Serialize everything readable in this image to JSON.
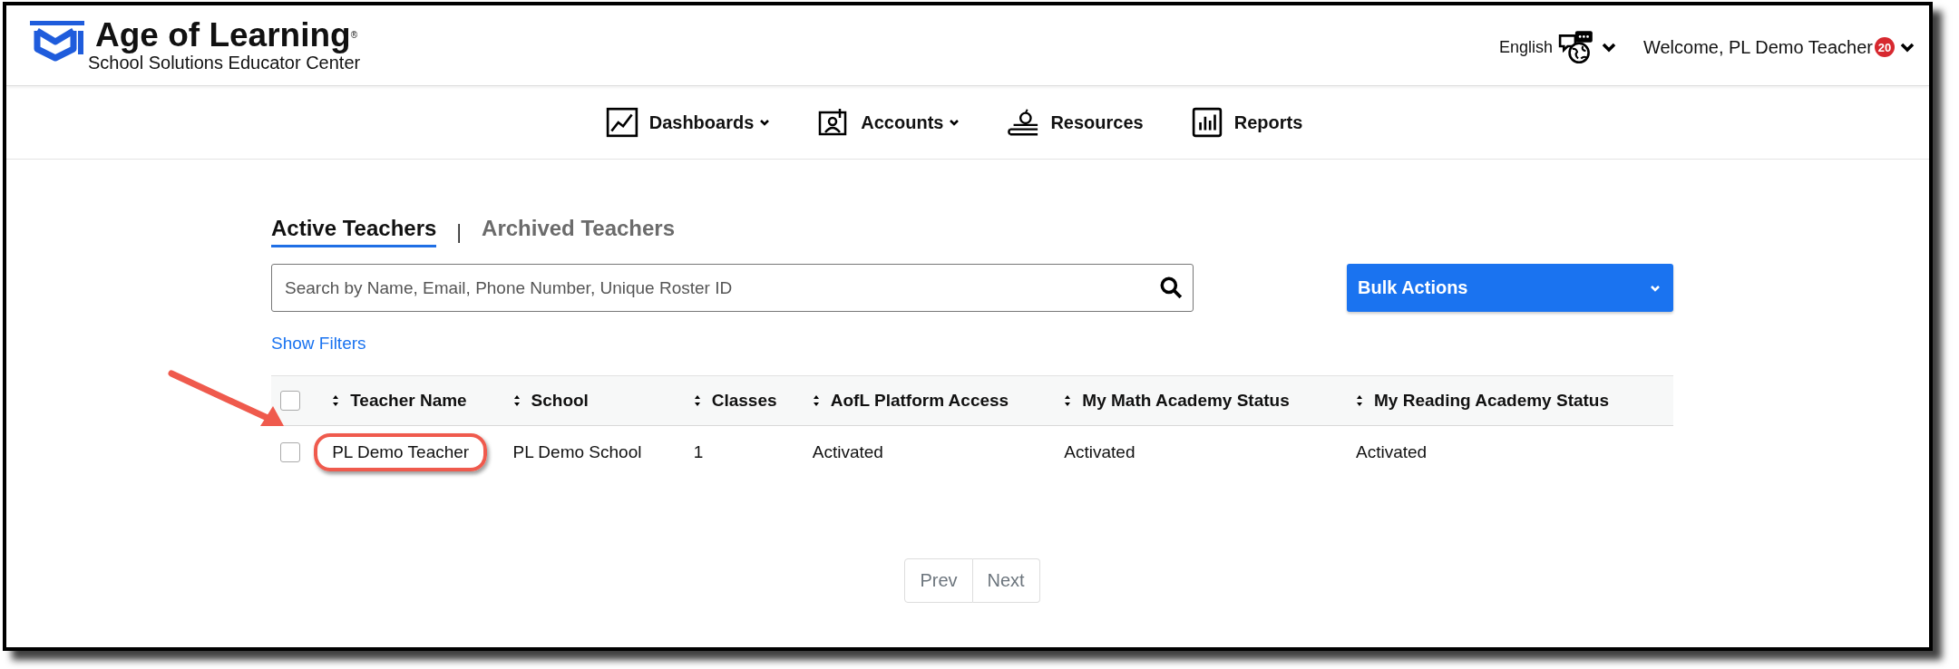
{
  "header": {
    "brand": "Age of Learning",
    "registered": "®",
    "subtitle": "School Solutions Educator Center",
    "language": "English",
    "welcome": "Welcome, PL Demo Teacher",
    "notification_count": "20"
  },
  "nav": [
    {
      "label": "Dashboards",
      "kind": "chart",
      "dropdown": true
    },
    {
      "label": "Accounts",
      "kind": "account",
      "dropdown": true
    },
    {
      "label": "Resources",
      "kind": "book",
      "dropdown": false
    },
    {
      "label": "Reports",
      "kind": "bars",
      "dropdown": false
    }
  ],
  "tabs": [
    {
      "label": "Active Teachers",
      "selected": true
    },
    {
      "label": "Archived Teachers",
      "selected": false
    }
  ],
  "tab_separator": "|",
  "search": {
    "placeholder": "Search by Name, Email, Phone Number, Unique Roster ID"
  },
  "bulk_actions": {
    "label": "Bulk Actions"
  },
  "show_filters": "Show Filters",
  "table": {
    "select_all_checked": false,
    "columns": [
      "Teacher Name",
      "School",
      "Classes",
      "AofL Platform Access",
      "My Math Academy Status",
      "My Reading Academy Status"
    ],
    "rows": [
      {
        "checked": false,
        "highlighted": true,
        "cells": [
          "PL Demo Teacher",
          "PL Demo School",
          "1",
          "Activated",
          "Activated",
          "Activated"
        ]
      }
    ]
  },
  "pagination": {
    "prev": "Prev",
    "next": "Next"
  }
}
